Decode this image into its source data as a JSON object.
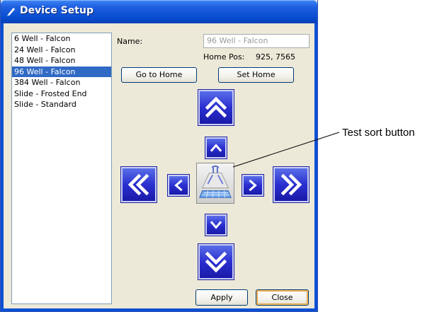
{
  "window": {
    "title": "Device Setup"
  },
  "devices": {
    "items": [
      {
        "label": "6 Well - Falcon",
        "selected": false
      },
      {
        "label": "24 Well - Falcon",
        "selected": false
      },
      {
        "label": "48 Well - Falcon",
        "selected": false
      },
      {
        "label": "96 Well - Falcon",
        "selected": true
      },
      {
        "label": "384 Well - Falcon",
        "selected": false
      },
      {
        "label": "Slide - Frosted End",
        "selected": false
      },
      {
        "label": "Slide - Standard",
        "selected": false
      }
    ]
  },
  "form": {
    "name_label": "Name:",
    "name_value": "96 Well - Falcon",
    "home_pos_label": "Home Pos:",
    "home_pos_value": "925, 7565"
  },
  "buttons": {
    "go_home": "Go to Home",
    "set_home": "Set Home",
    "apply": "Apply",
    "close": "Close"
  },
  "nav": {
    "up_large_icon": "double-chevron-up-icon",
    "up_small_icon": "chevron-up-icon",
    "left_large_icon": "double-chevron-left-icon",
    "left_small_icon": "chevron-left-icon",
    "right_small_icon": "chevron-right-icon",
    "right_large_icon": "double-chevron-right-icon",
    "down_small_icon": "chevron-down-icon",
    "down_large_icon": "double-chevron-down-icon",
    "center_icon": "test-sort-icon"
  },
  "callout": {
    "text": "Test sort button"
  },
  "colors": {
    "selection": "#316ac5",
    "nav_button": "#2a2fcf",
    "titlebar": "#0a4fd3",
    "dialog_bg": "#ece9d8"
  }
}
